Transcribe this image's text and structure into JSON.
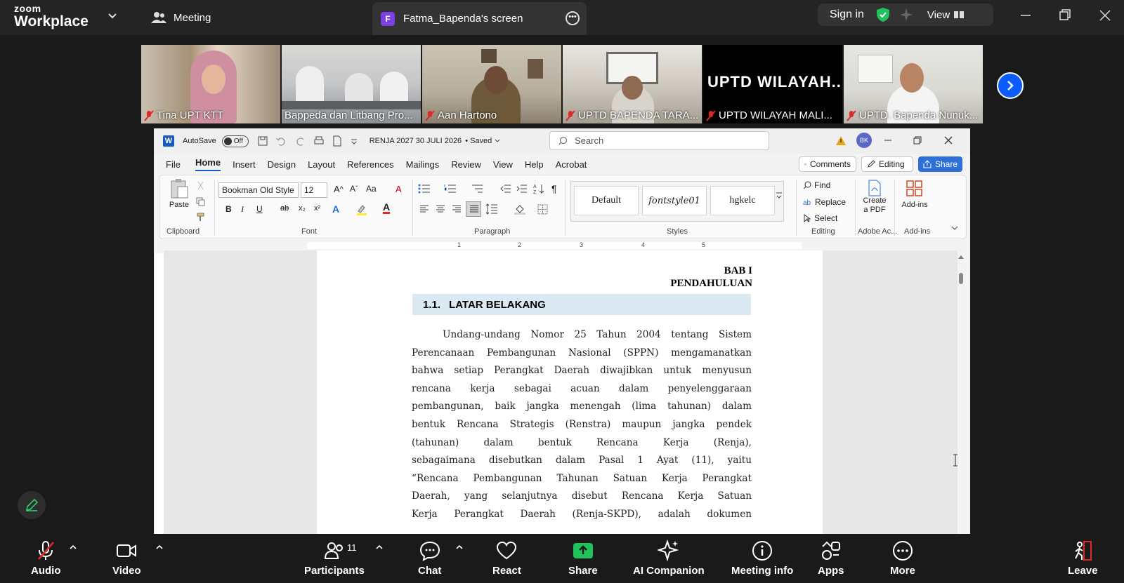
{
  "app": {
    "logo_top": "zoom",
    "logo_bottom": "Workplace",
    "meeting_tab": "Meeting",
    "share_tab": "Fatma_Bapenda's screen",
    "share_avatar": "F",
    "signin": "Sign in",
    "view": "View"
  },
  "participants_strip": [
    {
      "name": "Tina UPT KTT",
      "muted": true
    },
    {
      "name": "Bappeda dan Litbang Pro...",
      "muted": false
    },
    {
      "name": "Aan Hartono",
      "muted": true
    },
    {
      "name": "UPTD BAPENDA TARA...",
      "muted": true,
      "active": true
    },
    {
      "name": "UPTD WILAYAH MALI...",
      "muted": true,
      "big_label": "UPTD  WILAYAH..."
    },
    {
      "name": "UPTD. Bapenda Nunuk...",
      "muted": true
    }
  ],
  "word": {
    "autosave": "AutoSave",
    "autosave_state": "Off",
    "doc_title": "RENJA 2027 30 JULI 2026",
    "saved": "• Saved",
    "search_placeholder": "Search",
    "user_initials": "BK",
    "tabs": [
      "File",
      "Home",
      "Insert",
      "Design",
      "Layout",
      "References",
      "Mailings",
      "Review",
      "View",
      "Help",
      "Acrobat"
    ],
    "active_tab": "Home",
    "comments": "Comments",
    "editing": "Editing",
    "share": "Share",
    "ribbon": {
      "clipboard": "Clipboard",
      "paste": "Paste",
      "font_name": "Bookman Old Style",
      "font_size": "12",
      "font": "Font",
      "paragraph": "Paragraph",
      "styles": "Styles",
      "style_items": [
        "Default",
        "fontstyle01",
        "hgkelc"
      ],
      "find": "Find",
      "replace": "Replace",
      "select": "Select",
      "editing_group": "Editing",
      "create_pdf_1": "Create",
      "create_pdf_2": "a PDF",
      "adobe": "Adobe Ac...",
      "addins": "Add-ins",
      "addins_group": "Add-ins",
      "bold": "B",
      "italic": "I",
      "underline": "U"
    },
    "ruler_numbers": [
      "1",
      "2",
      "3",
      "4",
      "5"
    ],
    "document": {
      "bab": "BAB I",
      "pendahuluan": "PENDAHULUAN",
      "section_number": "1.1.",
      "section_title": "LATAR BELAKANG",
      "lines": [
        "Undang-undang Nomor 25 Tahun 2004 tentang Sistem",
        "Perencanaan Pembangunan Nasional (SPPN) mengamanatkan",
        "bahwa setiap Perangkat Daerah diwajibkan untuk menyusun",
        "rencana kerja sebagai acuan dalam penyelenggaraan",
        "pembangunan, baik jangka menengah (lima tahunan) dalam",
        "bentuk Rencana Strategis (Renstra) maupun jangka pendek",
        "(tahunan) dalam bentuk Rencana Kerja (Renja),",
        "sebagaimana disebutkan dalam Pasal 1 Ayat (11), yaitu",
        "“Rencana Pembangunan Tahunan Satuan Kerja Perangkat",
        "Daerah, yang selanjutnya disebut Rencana Kerja Satuan",
        "Kerja Perangkat Daerah (Renja-SKPD), adalah dokumen"
      ]
    }
  },
  "toolbar": {
    "audio": "Audio",
    "video": "Video",
    "participants": "Participants",
    "participants_count": "11",
    "chat": "Chat",
    "react": "React",
    "share": "Share",
    "ai_companion": "AI Companion",
    "meeting_info": "Meeting info",
    "apps": "Apps",
    "more": "More",
    "leave": "Leave"
  },
  "colors": {
    "zoom_blue": "#0b5cff",
    "share_green": "#21c25b",
    "active_border": "#2ecc71",
    "mute_red": "#e02828",
    "word_blue": "#185abd"
  }
}
